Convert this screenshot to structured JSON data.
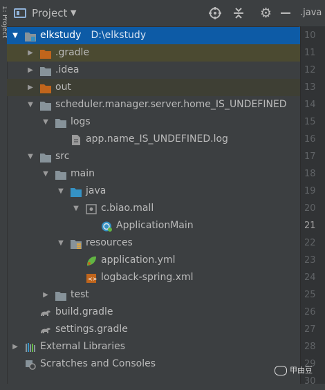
{
  "side_strip": {
    "label": "1: Project"
  },
  "header": {
    "title": "Project",
    "dropdown_icon": "chevron-down-icon"
  },
  "editor_tab": {
    "label": ".java"
  },
  "tree": [
    {
      "label": "elkstudy",
      "sub": "D:\\elkstudy",
      "icon": "module-folder-icon"
    },
    {
      "label": ".gradle",
      "icon": "excluded-folder-icon"
    },
    {
      "label": ".idea",
      "icon": "folder-icon"
    },
    {
      "label": "out",
      "icon": "excluded-folder-icon"
    },
    {
      "label": "scheduler.manager.server.home_IS_UNDEFINED",
      "icon": "folder-icon"
    },
    {
      "label": "logs",
      "icon": "folder-icon"
    },
    {
      "label": "app.name_IS_UNDEFINED.log",
      "icon": "file-icon"
    },
    {
      "label": "src",
      "icon": "folder-icon"
    },
    {
      "label": "main",
      "icon": "folder-icon"
    },
    {
      "label": "java",
      "icon": "source-folder-icon"
    },
    {
      "label": "c.biao.mall",
      "icon": "package-icon"
    },
    {
      "label": "ApplicationMain",
      "icon": "spring-boot-class-icon"
    },
    {
      "label": "resources",
      "icon": "resources-folder-icon"
    },
    {
      "label": "application.yml",
      "icon": "spring-yml-icon"
    },
    {
      "label": "logback-spring.xml",
      "icon": "xml-file-icon"
    },
    {
      "label": "test",
      "icon": "folder-icon"
    },
    {
      "label": "build.gradle",
      "icon": "gradle-icon"
    },
    {
      "label": "settings.gradle",
      "icon": "gradle-icon"
    },
    {
      "label": "External Libraries",
      "icon": "libraries-icon"
    },
    {
      "label": "Scratches and Consoles",
      "icon": "scratches-icon"
    }
  ],
  "line_numbers": [
    "10",
    "11",
    "12",
    "13",
    "14",
    "15",
    "16",
    "17",
    "18",
    "19",
    "20",
    "21",
    "22",
    "23",
    "24",
    "25",
    "26",
    "27",
    "28",
    "29",
    "30"
  ],
  "watermark": {
    "text": "甲由豆"
  },
  "colors": {
    "selection": "#0d5ba6",
    "panel": "#3c3f41",
    "folder": "#87939a",
    "excluded": "#c0651c"
  }
}
